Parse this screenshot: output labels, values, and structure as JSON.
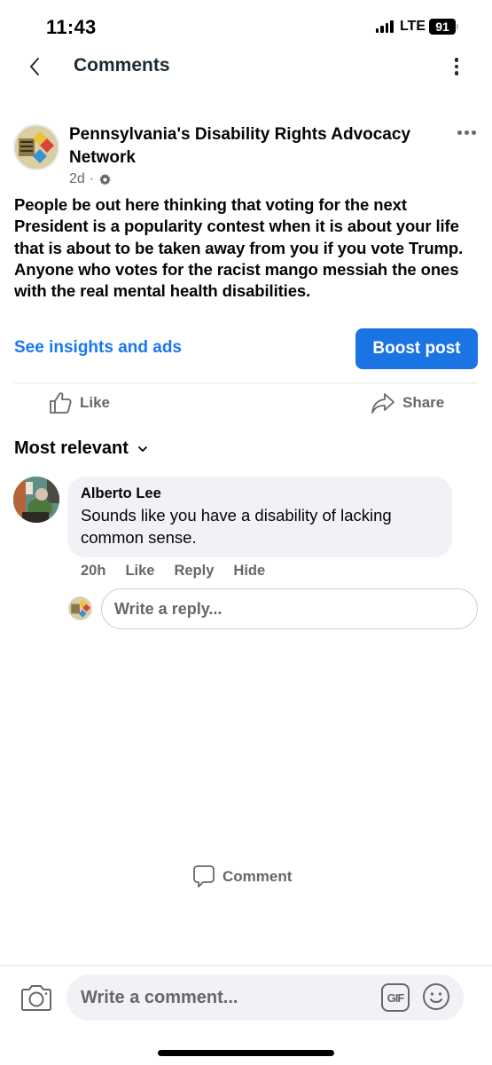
{
  "status_bar": {
    "time": "11:43",
    "network": "LTE",
    "battery": "91"
  },
  "nav": {
    "back_icon": "chevron-left-icon",
    "title": "Comments",
    "more_icon": "vertical-ellipsis-icon"
  },
  "post": {
    "page_name": "Pennsylvania's Disability Rights Advocacy Network",
    "time": "2d",
    "separator": "·",
    "audience_icon": "gear-icon",
    "options_icon": "horizontal-ellipsis-icon",
    "text": "People be out here thinking that voting for the next President is a popularity contest when it is about your life that is about to be taken away from you if you vote Trump. Anyone who votes for the racist mango messiah the ones with the real mental health disabilities.",
    "insights_link": "See insights and ads",
    "boost_button": "Boost post"
  },
  "actions": {
    "like": "Like",
    "comment": "Comment",
    "share": "Share"
  },
  "sort": {
    "label": "Most relevant"
  },
  "comments": [
    {
      "author": "Alberto Lee",
      "text": "Sounds like you have a disability of lacking common sense.",
      "time": "20h",
      "like": "Like",
      "reply": "Reply",
      "hide": "Hide"
    }
  ],
  "reply_box": {
    "placeholder": "Write a reply..."
  },
  "composer": {
    "placeholder": "Write a comment...",
    "gif_label": "GIF"
  },
  "colors": {
    "accent": "#1877f2",
    "boost_bg": "#1b74e4",
    "secondary_text": "#65676b",
    "bubble_bg": "#f0f2f5"
  }
}
